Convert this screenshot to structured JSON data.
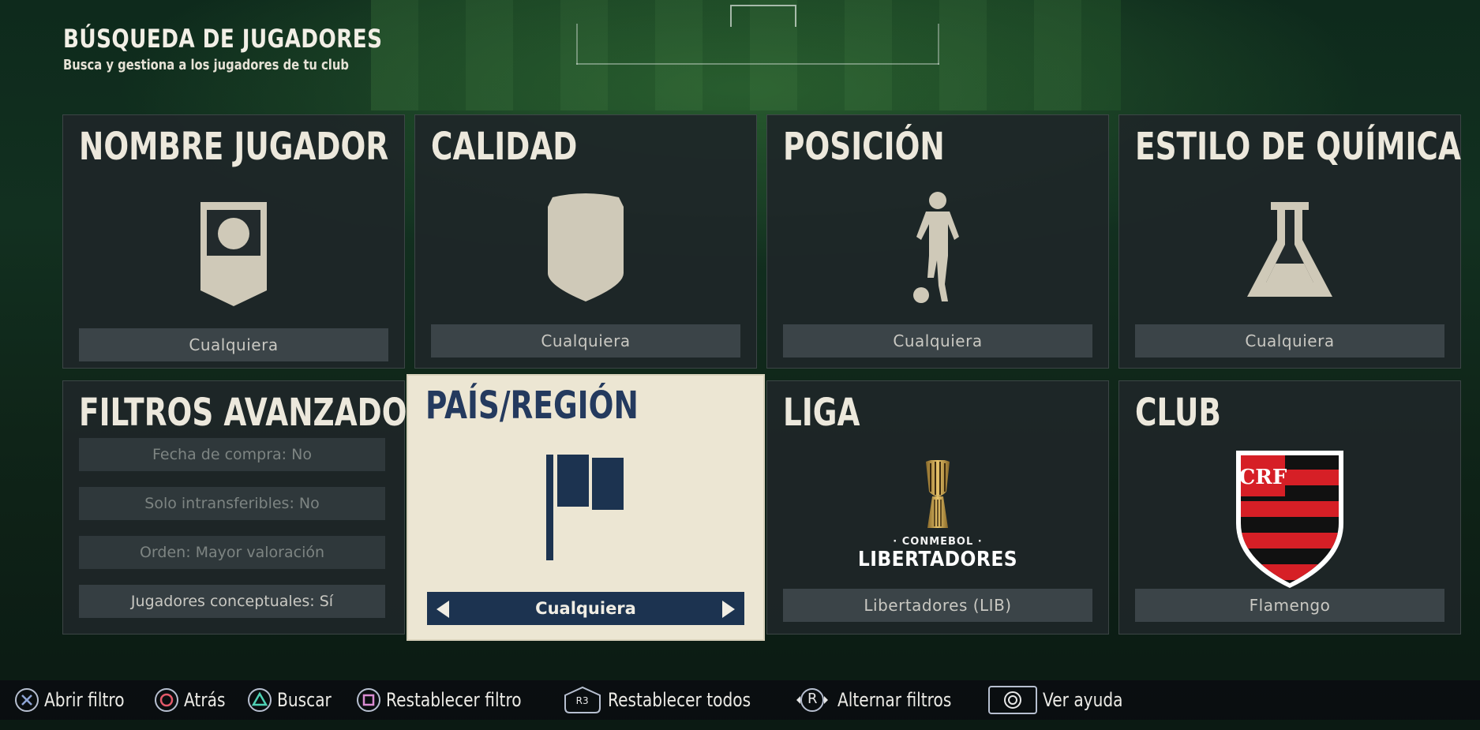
{
  "header": {
    "title": "BÚSQUEDA DE JUGADORES",
    "subtitle": "Busca y gestiona a los jugadores de tu club"
  },
  "tiles": {
    "player_name": {
      "title": "NOMBRE JUGADOR",
      "value": "Cualquiera",
      "icon": "player-card-icon"
    },
    "quality": {
      "title": "CALIDAD",
      "value": "Cualquiera",
      "icon": "shield-badge-icon"
    },
    "position": {
      "title": "POSICIÓN",
      "value": "Cualquiera",
      "icon": "player-silhouette-icon"
    },
    "chemistry": {
      "title": "ESTILO DE QUÍMICA",
      "value": "Cualquiera",
      "icon": "flask-icon"
    },
    "advanced": {
      "title": "FILTROS AVANZADOS",
      "rows": [
        "Fecha de compra: No",
        "Solo intransferibles: No",
        "Orden: Mayor valoración",
        "Jugadores conceptuales: Sí"
      ]
    },
    "country": {
      "title": "PAÍS/REGIÓN",
      "value": "Cualquiera",
      "icon": "flag-icon"
    },
    "league": {
      "title": "LIGA",
      "value": "Libertadores (LIB)",
      "logo_small": "· CONMEBOL ·",
      "logo_big": "LIBERTADORES"
    },
    "club": {
      "title": "CLUB",
      "value": "Flamengo",
      "crest_text": "CRF"
    }
  },
  "footer": {
    "open_filter": "Abrir filtro",
    "back": "Atrás",
    "search": "Buscar",
    "reset_filter": "Restablecer filtro",
    "r3_label": "R3",
    "reset_all": "Restablecer todos",
    "r_label": "R",
    "toggle_filters": "Alternar filtros",
    "help": "Ver ayuda"
  },
  "colors": {
    "tile_bg": "#1e2628",
    "selected_bg": "#ece6d3",
    "selected_accent": "#1c3350",
    "flamengo_red": "#d61f26",
    "flamengo_black": "#111111"
  }
}
